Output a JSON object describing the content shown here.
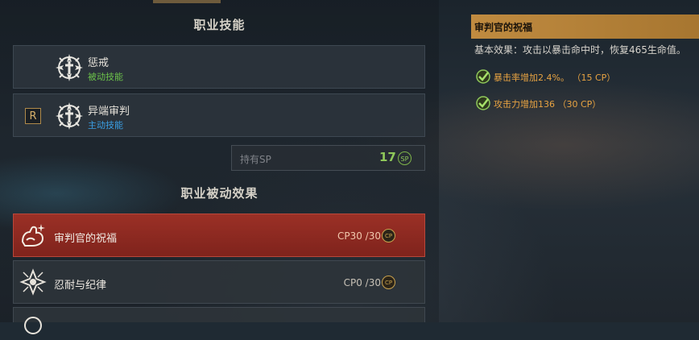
{
  "skills_section": {
    "title": "职业技能",
    "skills": [
      {
        "name": "惩戒",
        "type": "被动技能",
        "type_color": "#6cc24a",
        "icon": "holy-cross-emblem-icon"
      },
      {
        "name": "异端审判",
        "type": "主动技能",
        "type_color": "#3aa0e6",
        "key": "R",
        "icon": "holy-cross-emblem-icon"
      }
    ],
    "sp": {
      "label": "持有SP",
      "value": "17",
      "icon_text": "SP"
    }
  },
  "passive_section": {
    "title": "职业被动效果",
    "items": [
      {
        "name": "审判官的祝福",
        "cp": "CP30 /30",
        "active": true,
        "icon": "flexing-arm-icon",
        "cp_icon_text": "CP"
      },
      {
        "name": "忍耐与纪律",
        "cp": "CP0 /30",
        "active": false,
        "icon": "winged-emblem-icon",
        "cp_icon_text": "CP"
      }
    ]
  },
  "detail_panel": {
    "title": "审判官的祝福",
    "base_effect": "基本效果：攻击以暴击命中时，恢复465生命值。",
    "effects": [
      {
        "text": "暴击率增加2.4%。",
        "cp": "（15 CP）",
        "icon": "checkmark-icon"
      },
      {
        "text": "攻击力增加136",
        "cp": "（30 CP）",
        "icon": "checkmark-icon"
      }
    ]
  },
  "colors": {
    "active_row": "#9b3026",
    "header_gold": "#c08b40",
    "sp_green": "#8fc85a",
    "effect_orange": "#e8a342"
  }
}
